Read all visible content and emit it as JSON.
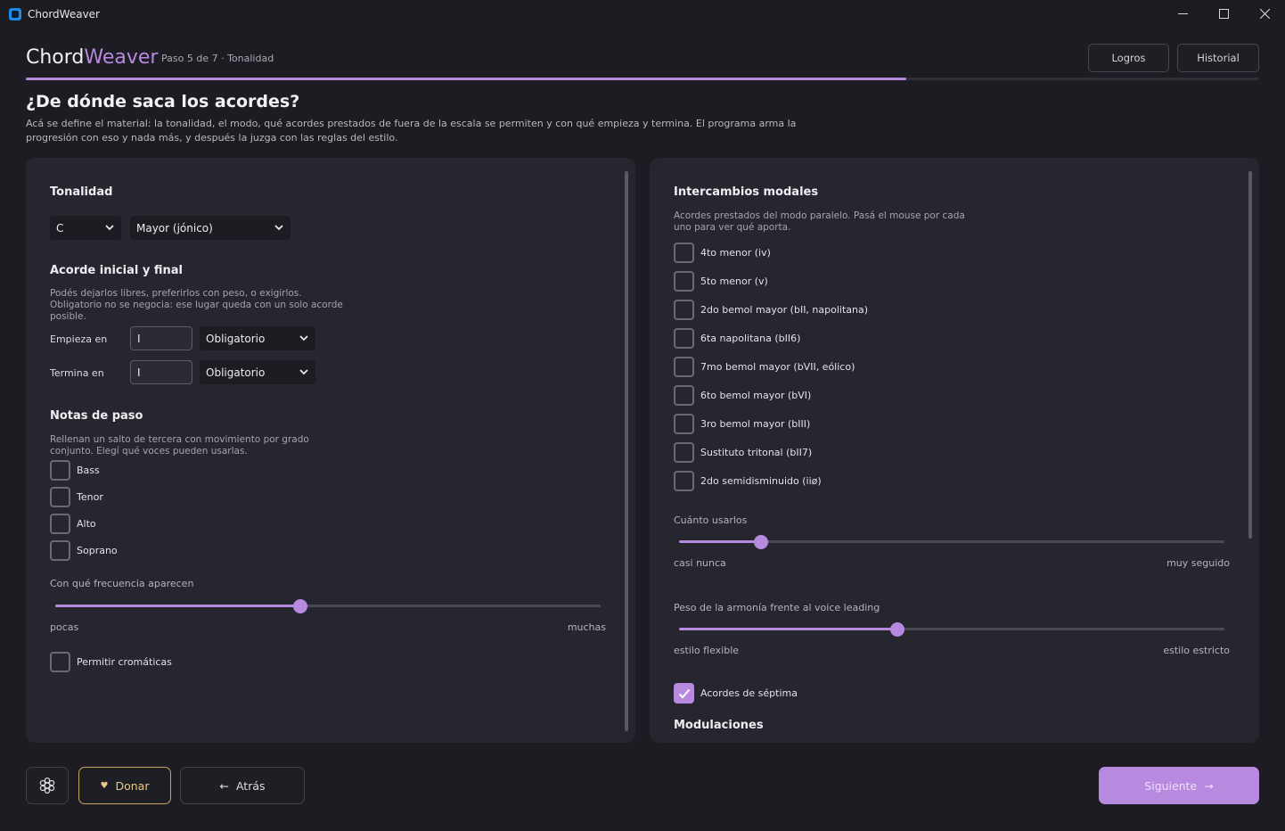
{
  "window": {
    "title": "ChordWeaver"
  },
  "header": {
    "brand_part1": "Chord",
    "brand_part2": "Weaver",
    "step": "Paso 5 de 7 · Tonalidad",
    "achievements_label": "Logros",
    "history_label": "Historial",
    "progress_fraction": 0.714
  },
  "page": {
    "title": "¿De dónde saca los acordes?",
    "description": "Acá se define el material: la tonalidad, el modo, qué acordes prestados de fuera de la escala se permiten y con qué empieza y termina. El programa arma la progresión con eso y nada más, y después la juzga con las reglas del estilo."
  },
  "left": {
    "key_title": "Tonalidad",
    "key_value": "C",
    "mode_value": "Mayor (jónico)",
    "start_end_title": "Acorde inicial y final",
    "start_end_hint": "Podés dejarlos libres, preferirlos con peso, o exigirlos. Obligatorio no se negocia: ese lugar queda con un solo acorde posible.",
    "start_label": "Empieza en",
    "start_value": "I",
    "start_mode": "Obligatorio",
    "end_label": "Termina en",
    "end_value": "I",
    "end_mode": "Obligatorio",
    "passing_title": "Notas de paso",
    "passing_hint": "Rellenan un salto de tercera con movimiento por grado conjunto. Elegí qué voces pueden usarlas.",
    "voices": [
      {
        "label": "Bass",
        "checked": false
      },
      {
        "label": "Tenor",
        "checked": false
      },
      {
        "label": "Alto",
        "checked": false
      },
      {
        "label": "Soprano",
        "checked": false
      }
    ],
    "frequency_label": "Con qué frecuencia aparecen",
    "frequency_value": 0.45,
    "frequency_min": "pocas",
    "frequency_max": "muchas",
    "chromatic_label": "Permitir cromáticas"
  },
  "right": {
    "modal_title": "Intercambios modales",
    "modal_hint": "Acordes prestados del modo paralelo. Pasá el mouse por cada uno para ver qué aporta.",
    "modal_items": [
      {
        "label": "4to menor (iv)",
        "checked": false
      },
      {
        "label": "5to menor (v)",
        "checked": false
      },
      {
        "label": "2do bemol mayor (bII, napolitana)",
        "checked": false
      },
      {
        "label": "6ta napolitana (bII6)",
        "checked": false
      },
      {
        "label": "7mo bemol mayor (bVII, eólico)",
        "checked": false
      },
      {
        "label": "6to bemol mayor (bVI)",
        "checked": false
      },
      {
        "label": "3ro bemol mayor (bIII)",
        "checked": false
      },
      {
        "label": "Sustituto tritonal (bII7)",
        "checked": false
      },
      {
        "label": "2do semidisminuido (iiø)",
        "checked": false
      }
    ],
    "usage_label": "Cuánto usarlos",
    "usage_value": 0.15,
    "usage_min": "casi nunca",
    "usage_max": "muy seguido",
    "weight_label": "Peso de la armonía frente al voice leading",
    "weight_value": 0.4,
    "weight_min": "estilo flexible",
    "weight_max": "estilo estricto",
    "seventh_label": "Acordes de séptima",
    "seventh_checked": true,
    "modulation_title": "Modulaciones"
  },
  "footer": {
    "donate_label": "Donar",
    "back_label": "Atrás",
    "next_label": "Siguiente"
  },
  "icons": {
    "settings": "gear-icon",
    "donate": "heart-icon",
    "back": "arrow-left-icon",
    "next": "arrow-right-icon"
  },
  "colors": {
    "accent": "#b78ae0",
    "donate": "#c5a363",
    "background": "#1c1c22",
    "panel": "#26262e"
  }
}
